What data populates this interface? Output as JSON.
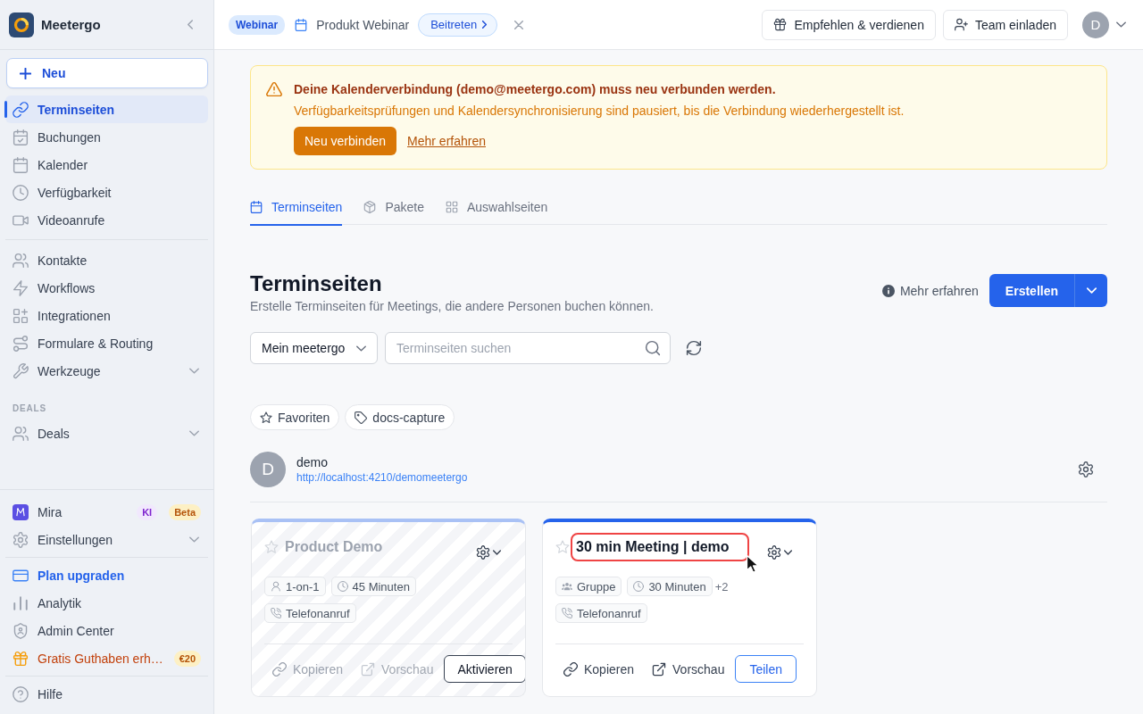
{
  "sidebar": {
    "brand": "Meetergo",
    "new_button": "Neu",
    "nav_groups": [
      {
        "items": [
          {
            "label": "Terminseiten",
            "kind": "link",
            "selected": true
          },
          {
            "label": "Buchungen",
            "kind": "link",
            "selected": false
          },
          {
            "label": "Kalender",
            "kind": "link",
            "selected": false
          },
          {
            "label": "Verfügbarkeit",
            "kind": "link",
            "selected": false
          },
          {
            "label": "Videoanrufe",
            "kind": "link",
            "selected": false
          }
        ]
      },
      {
        "items": [
          {
            "label": "Kontakte",
            "kind": "link",
            "selected": false
          },
          {
            "label": "Workflows",
            "kind": "link",
            "selected": false
          },
          {
            "label": "Integrationen",
            "kind": "link",
            "selected": false
          },
          {
            "label": "Formulare & Routing",
            "kind": "link",
            "selected": false
          },
          {
            "label": "Werkzeuge",
            "kind": "group",
            "selected": false
          }
        ]
      },
      {
        "heading": "DEALS",
        "items": [
          {
            "label": "Deals",
            "kind": "group",
            "selected": false
          }
        ]
      }
    ],
    "footer_groups": [
      {
        "items": [
          {
            "label": "Mira",
            "kind": "link",
            "selected": false,
            "badges": [
              {
                "label": "KI",
                "kind": "ai"
              },
              {
                "label": "Beta",
                "kind": "beta"
              }
            ]
          },
          {
            "label": "Einstellungen",
            "kind": "group",
            "selected": false
          }
        ]
      },
      {
        "items": [
          {
            "label": "Plan upgraden",
            "kind": "upgrade",
            "selected": false
          },
          {
            "label": "Analytik",
            "kind": "link",
            "selected": false
          },
          {
            "label": "Admin Center",
            "kind": "link",
            "selected": false
          },
          {
            "label": "Gratis Guthaben erh…",
            "kind": "promo",
            "selected": false,
            "badges": [
              {
                "label": "€20",
                "kind": "credit"
              }
            ]
          }
        ]
      },
      {
        "items": [
          {
            "label": "Hilfe",
            "kind": "link",
            "selected": false
          }
        ]
      }
    ]
  },
  "topbar": {
    "webinar": {
      "badge": "Webinar",
      "title": "Produkt Webinar",
      "join_button": "Beitreten"
    },
    "buttons": [
      "Empfehlen & verdienen",
      "Team einladen"
    ],
    "user_initial": "D"
  },
  "alert": {
    "title": "Deine Kalenderverbindung (demo@meetergo.com) muss neu verbunden werden.",
    "message": "Verfügbarkeitsprüfungen und Kalendersynchronisierung sind pausiert, bis die Verbindung wiederhergestellt ist.",
    "button": "Neu verbinden",
    "link": "Mehr erfahren"
  },
  "tabs": [
    {
      "label": "Terminseiten",
      "selected": true
    },
    {
      "label": "Pakete",
      "selected": false
    },
    {
      "label": "Auswahlseiten",
      "selected": false
    }
  ],
  "header": {
    "title": "Terminseiten",
    "subtitle": "Erstelle Terminseiten für Meetings, die andere Personen buchen können.",
    "help_link": "Mehr erfahren",
    "create_button": "Erstellen"
  },
  "filters": {
    "scope": "Mein meetergo",
    "search": {
      "placeholder": "Terminseiten suchen"
    }
  },
  "chips": [
    {
      "label": "Favoriten",
      "kind": "favorites"
    },
    {
      "label": "docs-capture",
      "kind": "tag"
    }
  ],
  "owner": {
    "initial": "D",
    "name": "demo",
    "url": "http://localhost:4210/demomeetergo"
  },
  "cards": [
    {
      "title": "Product Demo",
      "disabled": true,
      "favorite": false,
      "highlighted": false,
      "tags": [
        {
          "label": "1-on-1",
          "kind": "individual"
        },
        {
          "label": "45 Minuten",
          "kind": "duration"
        }
      ],
      "locations": [
        {
          "label": "Telefonanruf",
          "kind": "call"
        }
      ],
      "actions": [
        "Kopieren",
        "Vorschau"
      ],
      "primary_button": "Aktivieren"
    },
    {
      "title": "30 min Meeting | demo",
      "disabled": false,
      "favorite": false,
      "highlighted": true,
      "tags": [
        {
          "label": "Gruppe",
          "kind": "group"
        },
        {
          "label": "30 Minuten",
          "kind": "duration"
        }
      ],
      "more": "+2",
      "locations": [
        {
          "label": "Telefonanruf",
          "kind": "call"
        }
      ],
      "actions": [
        "Kopieren",
        "Vorschau"
      ],
      "primary_button": "Teilen"
    }
  ]
}
